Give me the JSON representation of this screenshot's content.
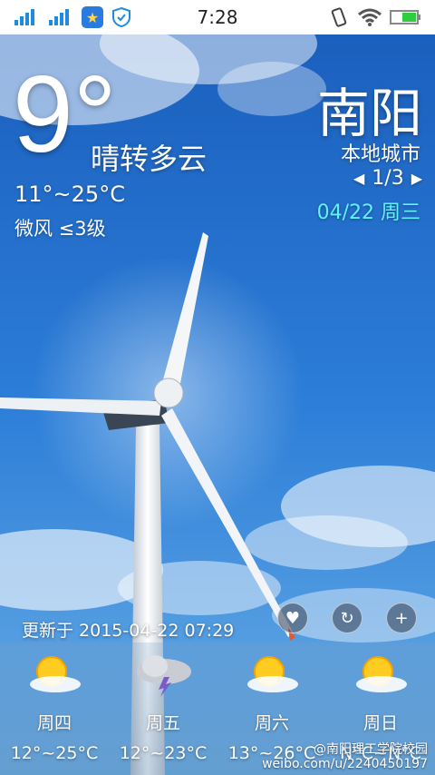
{
  "status_bar": {
    "time": "7:28",
    "icons": [
      "signal-icon",
      "signal-icon",
      "app-star-icon",
      "shield-icon",
      "vibrate-icon",
      "wifi-icon",
      "battery-icon"
    ]
  },
  "weather": {
    "current_temp": "9°",
    "condition": "晴转多云",
    "range": "11°~25°C",
    "wind": "微风 ≤3级"
  },
  "city": {
    "name": "南阳",
    "subtitle": "本地城市",
    "page": "1/3",
    "date": "04/22 周三"
  },
  "updated": "更新于 2015-04-22 07:29",
  "forecast": [
    {
      "day": "周四",
      "range": "12°~25°C",
      "icon": "sunny-cloudy-icon"
    },
    {
      "day": "周五",
      "range": "12°~23°C",
      "icon": "thunderstorm-icon"
    },
    {
      "day": "周六",
      "range": "13°~26°C",
      "icon": "sunny-cloudy-icon"
    },
    {
      "day": "周日",
      "range": "N°C~N°C",
      "icon": "sunny-cloudy-icon"
    }
  ],
  "watermark": {
    "line1": "@南阳理工学院校园",
    "line2": "weibo.com/u/2240450197"
  },
  "colors": {
    "sky_top": "#1d64c2",
    "sky_bottom": "#4a98df",
    "date_accent": "#5ef3ff"
  }
}
